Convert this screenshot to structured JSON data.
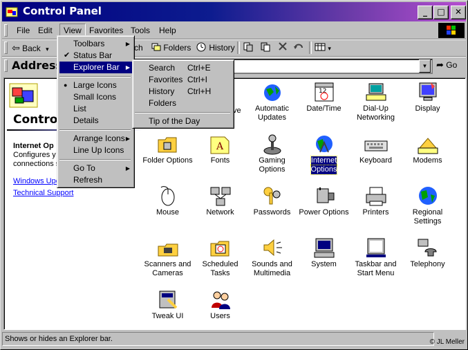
{
  "window": {
    "title": "Control Panel",
    "minimize": "_",
    "maximize": "□",
    "close": "✕"
  },
  "menubar": {
    "items": [
      "File",
      "Edit",
      "View",
      "Favorites",
      "Tools",
      "Help"
    ]
  },
  "toolbar": {
    "back": "Back",
    "back_arrow": "▾",
    "search_tail": "ch",
    "folders": "Folders",
    "history": "History",
    "views_arrow": "▾"
  },
  "address": {
    "label": "Address",
    "value": "",
    "go": "Go",
    "dropdown_arrow": "▼"
  },
  "left_panel": {
    "title": "Control",
    "section_heading": "Internet Op",
    "description_line1": "Configures y",
    "description_line2": "connections s",
    "link1": "Windows Upc",
    "link2": "Technical Support"
  },
  "icons": [
    {
      "label1": "Automatic",
      "label2": "Updates",
      "icon": "globe-update-icon"
    },
    {
      "label1": "Date/Time",
      "label2": "",
      "icon": "calendar-clock-icon"
    },
    {
      "label1": "Dial-Up",
      "label2": "Networking",
      "icon": "dialup-icon"
    },
    {
      "label1": "Display",
      "label2": "",
      "icon": "monitor-icon"
    },
    {
      "label1": "Folder Options",
      "label2": "",
      "icon": "folder-options-icon"
    },
    {
      "label1": "Fonts",
      "label2": "",
      "icon": "fonts-icon"
    },
    {
      "label1": "Gaming",
      "label2": "Options",
      "icon": "joystick-icon"
    },
    {
      "label1": "Internet",
      "label2": "Options",
      "icon": "internet-icon"
    },
    {
      "label1": "Keyboard",
      "label2": "",
      "icon": "keyboard-icon"
    },
    {
      "label1": "Modems",
      "label2": "",
      "icon": "modem-icon"
    },
    {
      "label1": "Mouse",
      "label2": "",
      "icon": "mouse-icon"
    },
    {
      "label1": "Network",
      "label2": "",
      "icon": "network-icon"
    },
    {
      "label1": "Passwords",
      "label2": "",
      "icon": "keys-icon"
    },
    {
      "label1": "Power Options",
      "label2": "",
      "icon": "power-icon"
    },
    {
      "label1": "Printers",
      "label2": "",
      "icon": "printer-icon"
    },
    {
      "label1": "Regional",
      "label2": "Settings",
      "icon": "globe-icon"
    },
    {
      "label1": "Scanners and",
      "label2": "Cameras",
      "icon": "scanner-icon"
    },
    {
      "label1": "Scheduled",
      "label2": "Tasks",
      "icon": "scheduled-tasks-icon"
    },
    {
      "label1": "Sounds and",
      "label2": "Multimedia",
      "icon": "speaker-icon"
    },
    {
      "label1": "System",
      "label2": "",
      "icon": "computer-icon"
    },
    {
      "label1": "Taskbar and",
      "label2": "Start Menu",
      "icon": "taskbar-icon"
    },
    {
      "label1": "Telephony",
      "label2": "",
      "icon": "telephony-icon"
    },
    {
      "label1": "Tweak UI",
      "label2": "",
      "icon": "tweakui-icon"
    },
    {
      "label1": "Users",
      "label2": "",
      "icon": "users-icon"
    }
  ],
  "partial_icon_label": "ve",
  "view_menu": {
    "toolbars": "Toolbars",
    "status_bar": "Status Bar",
    "explorer_bar": "Explorer Bar",
    "large_icons": "Large Icons",
    "small_icons": "Small Icons",
    "list": "List",
    "details": "Details",
    "arrange_icons": "Arrange Icons",
    "line_up_icons": "Line Up Icons",
    "go_to": "Go To",
    "refresh": "Refresh",
    "check": "✔",
    "bullet": "●",
    "arrow": "▶"
  },
  "explorer_bar_menu": {
    "search": "Search",
    "search_key": "Ctrl+E",
    "favorites": "Favorites",
    "favorites_key": "Ctrl+I",
    "history": "History",
    "history_key": "Ctrl+H",
    "folders": "Folders",
    "tip": "Tip of the Day"
  },
  "status": {
    "text": "Shows or hides an Explorer bar.",
    "copyright": "© JL Meller"
  },
  "colors": {
    "accent": "#000080",
    "face": "#c0c0c0"
  }
}
